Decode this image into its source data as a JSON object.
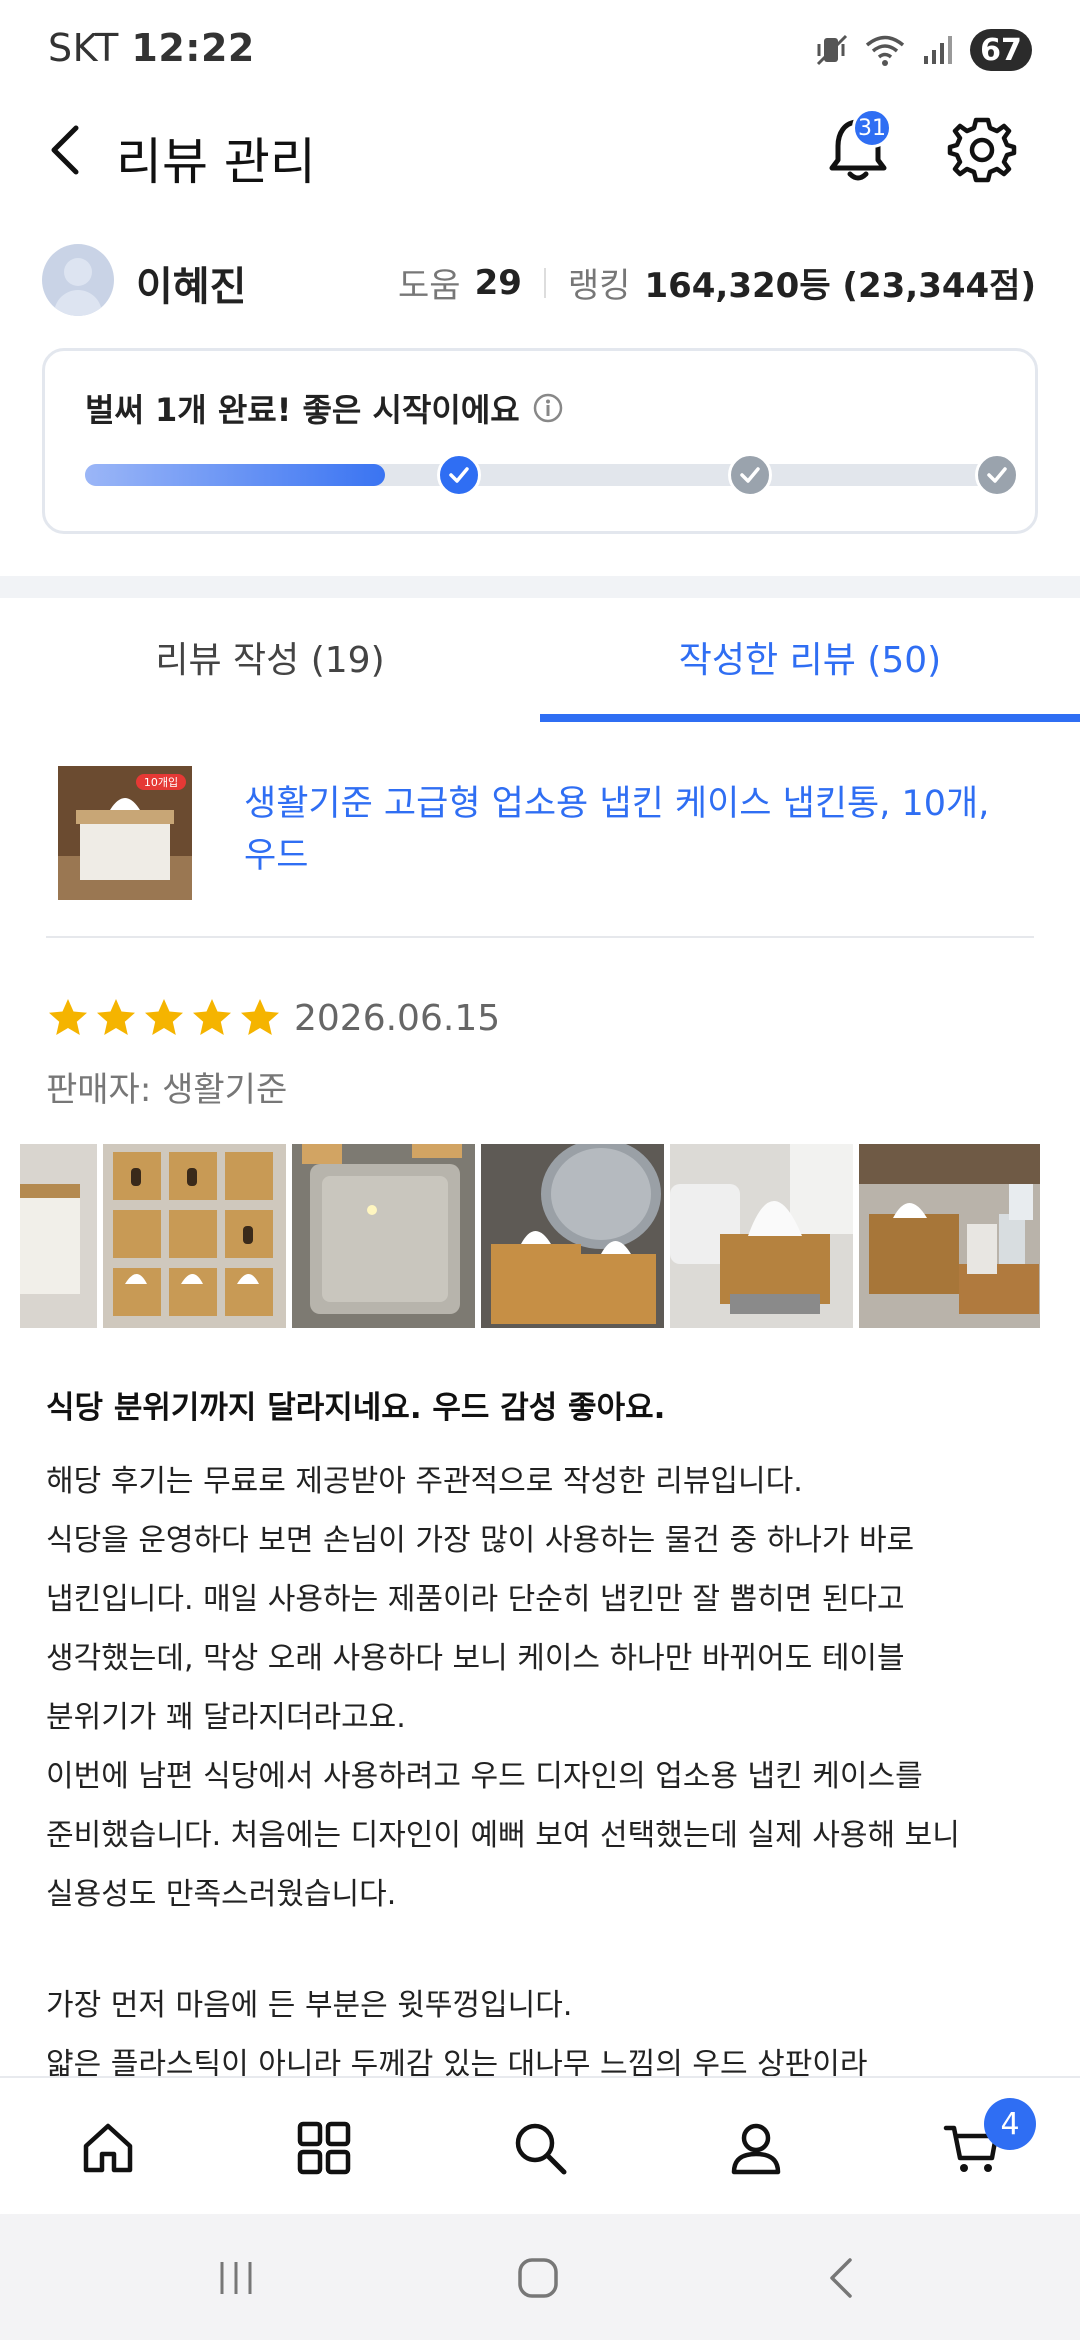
{
  "status_bar": {
    "carrier": "SKT",
    "time": "12:22",
    "battery": "67",
    "icons": [
      "mute-vibrate-icon",
      "wifi-icon",
      "signal-icon",
      "battery-icon"
    ]
  },
  "header": {
    "title": "리뷰 관리",
    "notification_count": "31"
  },
  "profile": {
    "name": "이혜진",
    "help_label": "도움",
    "help_value": "29",
    "ranking_label": "랭킹",
    "ranking_value": "164,320등 (23,344점)"
  },
  "progress": {
    "title": "벌써 1개 완료! 좋은 시작이에요",
    "completed_steps": 1,
    "total_steps": 3,
    "fill_fraction": 0.33
  },
  "tabs": [
    {
      "label": "리뷰 작성 (19)",
      "active": false
    },
    {
      "label": "작성한 리뷰 (50)",
      "active": true
    }
  ],
  "product": {
    "name": "생활기준 고급형 업소용 냅킨 케이스 냅킨통, 10개,\n우드",
    "thumb_tag": "10개입"
  },
  "review": {
    "rating": 5,
    "date": "2026.06.15",
    "seller": "판매자: 생활기준",
    "title": "식당 분위기까지 달라지네요. 우드 감성 좋아요.",
    "photo_count": 6,
    "lines": [
      "해당 후기는 무료로 제공받아 주관적으로 작성한 리뷰입니다.",
      "식당을 운영하다 보면 손님이 가장 많이 사용하는 물건 중 하나가 바로",
      "냅킨입니다. 매일 사용하는 제품이라 단순히 냅킨만 잘 뽑히면 된다고",
      "생각했는데, 막상 오래 사용하다 보니 케이스 하나만 바뀌어도 테이블",
      "분위기가 꽤 달라지더라고요.",
      "이번에 남편 식당에서 사용하려고 우드 디자인의 업소용 냅킨 케이스를",
      "준비했습니다. 처음에는 디자인이 예뻐 보여 선택했는데 실제 사용해 보니",
      "실용성도 만족스러웠습니다.",
      "",
      "가장 먼저 마음에 든 부분은 윗뚜껑입니다.",
      "얇은 플라스틱이 아니라 두께감 있는 대나무 느낌의 우드 상판이라"
    ]
  },
  "bottom_nav": {
    "items": [
      "home-icon",
      "categories-icon",
      "search-icon",
      "profile-icon",
      "cart-icon"
    ],
    "cart_count": "4"
  },
  "colors": {
    "accent": "#2f6ef3",
    "star": "#f5b400",
    "progress_inactive": "#9aa3ad"
  }
}
